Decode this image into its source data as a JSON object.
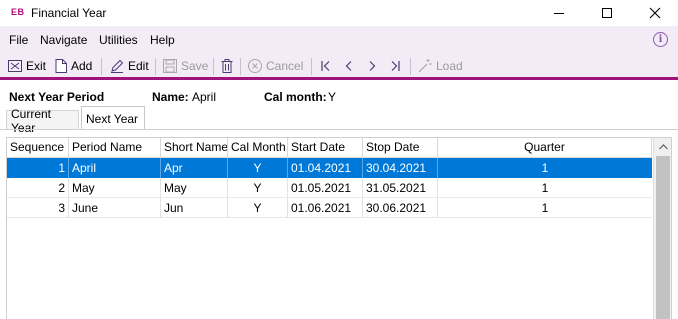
{
  "window": {
    "badge": "EB",
    "title": "Financial Year"
  },
  "menu": {
    "file": "File",
    "navigate": "Navigate",
    "utilities": "Utilities",
    "help": "Help",
    "info_icon": "i"
  },
  "toolbar": {
    "exit": "Exit",
    "add": "Add",
    "edit": "Edit",
    "save": "Save",
    "cancel": "Cancel",
    "load": "Load"
  },
  "header": {
    "period_label": "Next Year Period",
    "name_label": "Name:",
    "name_value": "April",
    "cal_month_label": "Cal month:",
    "cal_month_value": "Y"
  },
  "tabs": {
    "current_year": "Current Year",
    "next_year": "Next Year",
    "active": "Next Year"
  },
  "grid": {
    "columns": {
      "sequence": "Sequence",
      "period_name": "Period Name",
      "short_name": "Short Name",
      "cal_month": "Cal Month",
      "start_date": "Start Date",
      "stop_date": "Stop Date",
      "quarter": "Quarter"
    },
    "rows": [
      {
        "sequence": "1",
        "period_name": "April",
        "short_name": "Apr",
        "cal_month": "Y",
        "start_date": "01.04.2021",
        "stop_date": "30.04.2021",
        "quarter": "1"
      },
      {
        "sequence": "2",
        "period_name": "May",
        "short_name": "May",
        "cal_month": "Y",
        "start_date": "01.05.2021",
        "stop_date": "31.05.2021",
        "quarter": "1"
      },
      {
        "sequence": "3",
        "period_name": "June",
        "short_name": "Jun",
        "cal_month": "Y",
        "start_date": "01.06.2021",
        "stop_date": "30.06.2021",
        "quarter": "1"
      }
    ],
    "selected_row": 0
  },
  "colors": {
    "accent": "#a0137c",
    "selection": "#0078d7",
    "toolbar_bg": "#f3ecf6"
  }
}
